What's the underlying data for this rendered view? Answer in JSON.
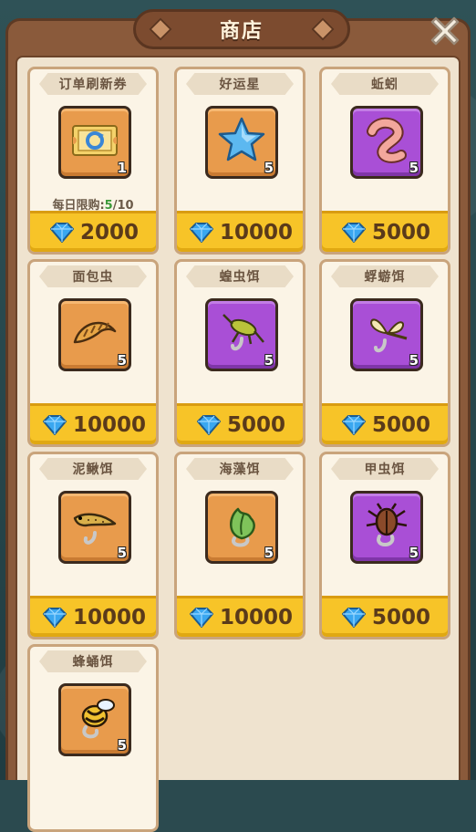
{
  "header": {
    "title": "商店"
  },
  "limit_text": {
    "prefix": "每日限购:",
    "current": "5",
    "max": "/10"
  },
  "items": [
    {
      "name": "订单刷新券",
      "qty": "1",
      "price": "2000",
      "icon": "refresh-ticket-icon",
      "bg": "orange"
    },
    {
      "name": "好运星",
      "qty": "5",
      "price": "10000",
      "icon": "lucky-star-icon",
      "bg": "orange"
    },
    {
      "name": "蚯蚓",
      "qty": "5",
      "price": "5000",
      "icon": "earthworm-icon",
      "bg": "purple"
    },
    {
      "name": "面包虫",
      "qty": "5",
      "price": "10000",
      "icon": "mealworm-icon",
      "bg": "orange"
    },
    {
      "name": "蝗虫饵",
      "qty": "5",
      "price": "5000",
      "icon": "locust-bait-icon",
      "bg": "purple"
    },
    {
      "name": "蜉蝣饵",
      "qty": "5",
      "price": "5000",
      "icon": "mayfly-bait-icon",
      "bg": "purple"
    },
    {
      "name": "泥鳅饵",
      "qty": "5",
      "price": "10000",
      "icon": "loach-bait-icon",
      "bg": "orange"
    },
    {
      "name": "海藻饵",
      "qty": "5",
      "price": "10000",
      "icon": "seaweed-bait-icon",
      "bg": "orange"
    },
    {
      "name": "甲虫饵",
      "qty": "5",
      "price": "5000",
      "icon": "beetle-bait-icon",
      "bg": "purple"
    },
    {
      "name": "蜂蛹饵",
      "qty": "5",
      "price": "",
      "icon": "bee-pupa-bait-icon",
      "bg": "orange"
    }
  ],
  "colors": {
    "frame": "#8a5a3b",
    "panel": "#efe3cf",
    "price_bar": "#f7c428",
    "gem": "#3aa7f0",
    "purple_box": "#a94fd6",
    "orange_box": "#e89b4c"
  }
}
